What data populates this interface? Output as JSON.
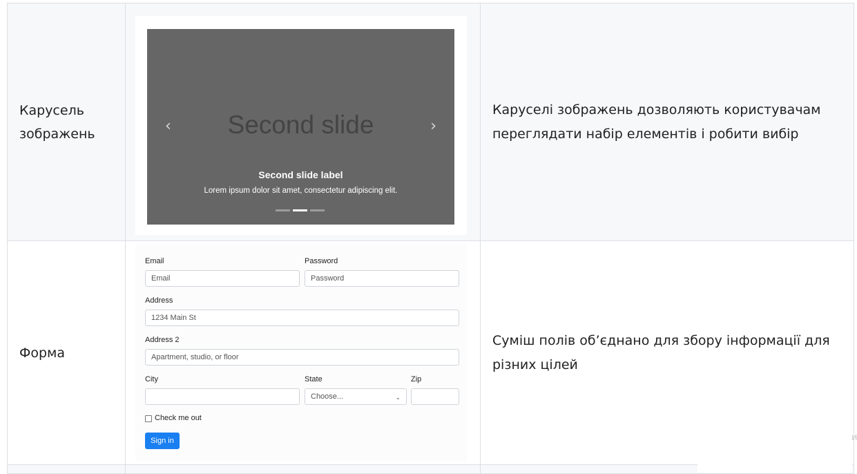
{
  "rows": [
    {
      "label": "Карусель зображень",
      "description": "Каруселі зображень дозволяють користувачам переглядати набір елементів і робити вибір",
      "carousel": {
        "slide_title": "Second slide",
        "caption_title": "Second slide label",
        "caption_text": "Lorem ipsum dolor sit amet, consectetur adipiscing elit.",
        "prev_glyph": "‹",
        "next_glyph": "›",
        "indicator_count": 3,
        "active_indicator": 2
      }
    },
    {
      "label": "Форма",
      "description": "Суміш полів об’єднано для збору інформації для різних цілей",
      "form": {
        "email_label": "Email",
        "email_placeholder": "Email",
        "password_label": "Password",
        "password_placeholder": "Password",
        "address_label": "Address",
        "address_placeholder": "1234 Main St",
        "address2_label": "Address 2",
        "address2_placeholder": "Apartment, studio, or floor",
        "city_label": "City",
        "state_label": "State",
        "state_value": "Choose...",
        "zip_label": "Zip",
        "checkbox_label": "Check me out",
        "submit_label": "Sign in"
      }
    }
  ],
  "stray_glyph": "и",
  "colors": {
    "carousel_bg": "#666666",
    "button_bg": "#1a7ff0",
    "row_alt_bg": "#f7f8fa"
  }
}
